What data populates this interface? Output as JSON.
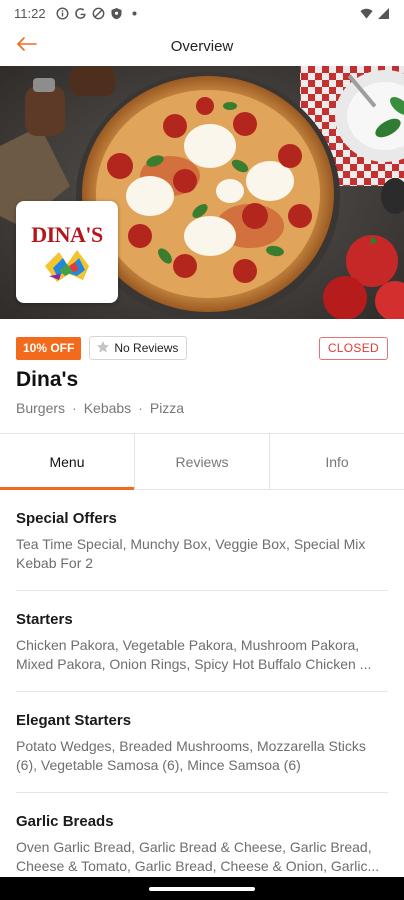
{
  "status_bar": {
    "time": "11:22",
    "icons": [
      "info-icon",
      "google-icon",
      "vpn-icon",
      "shield-icon",
      "dot-icon"
    ],
    "right_icons": [
      "wifi-icon",
      "signal-icon"
    ]
  },
  "app_bar": {
    "title": "Overview",
    "back_icon": "arrow-left-icon",
    "accent_color": "#f26a1b"
  },
  "restaurant": {
    "logo_text": "DINA'S",
    "discount_badge": "10% OFF",
    "reviews_badge": "No Reviews",
    "status_badge": "CLOSED",
    "name": "Dina's",
    "cuisines": [
      "Burgers",
      "Kebabs",
      "Pizza"
    ]
  },
  "tabs": [
    {
      "label": "Menu",
      "active": true
    },
    {
      "label": "Reviews",
      "active": false
    },
    {
      "label": "Info",
      "active": false
    }
  ],
  "menu_categories": [
    {
      "title": "Special Offers",
      "items": "Tea Time Special, Munchy Box, Veggie Box, Special Mix Kebab For 2"
    },
    {
      "title": "Starters",
      "items": "Chicken Pakora, Vegetable Pakora, Mushroom Pakora, Mixed Pakora, Onion Rings, Spicy Hot Buffalo Chicken ..."
    },
    {
      "title": "Elegant Starters",
      "items": "Potato Wedges, Breaded Mushrooms, Mozzarella Sticks (6), Vegetable Samosa (6), Mince Samsoa (6)"
    },
    {
      "title": "Garlic Breads",
      "items": "Oven Garlic Bread, Garlic Bread & Cheese, Garlic Bread, Cheese & Tomato, Garlic Bread, Cheese & Onion, Garlic..."
    }
  ],
  "colors": {
    "accent": "#f26a1b",
    "closed": "#e53935"
  }
}
